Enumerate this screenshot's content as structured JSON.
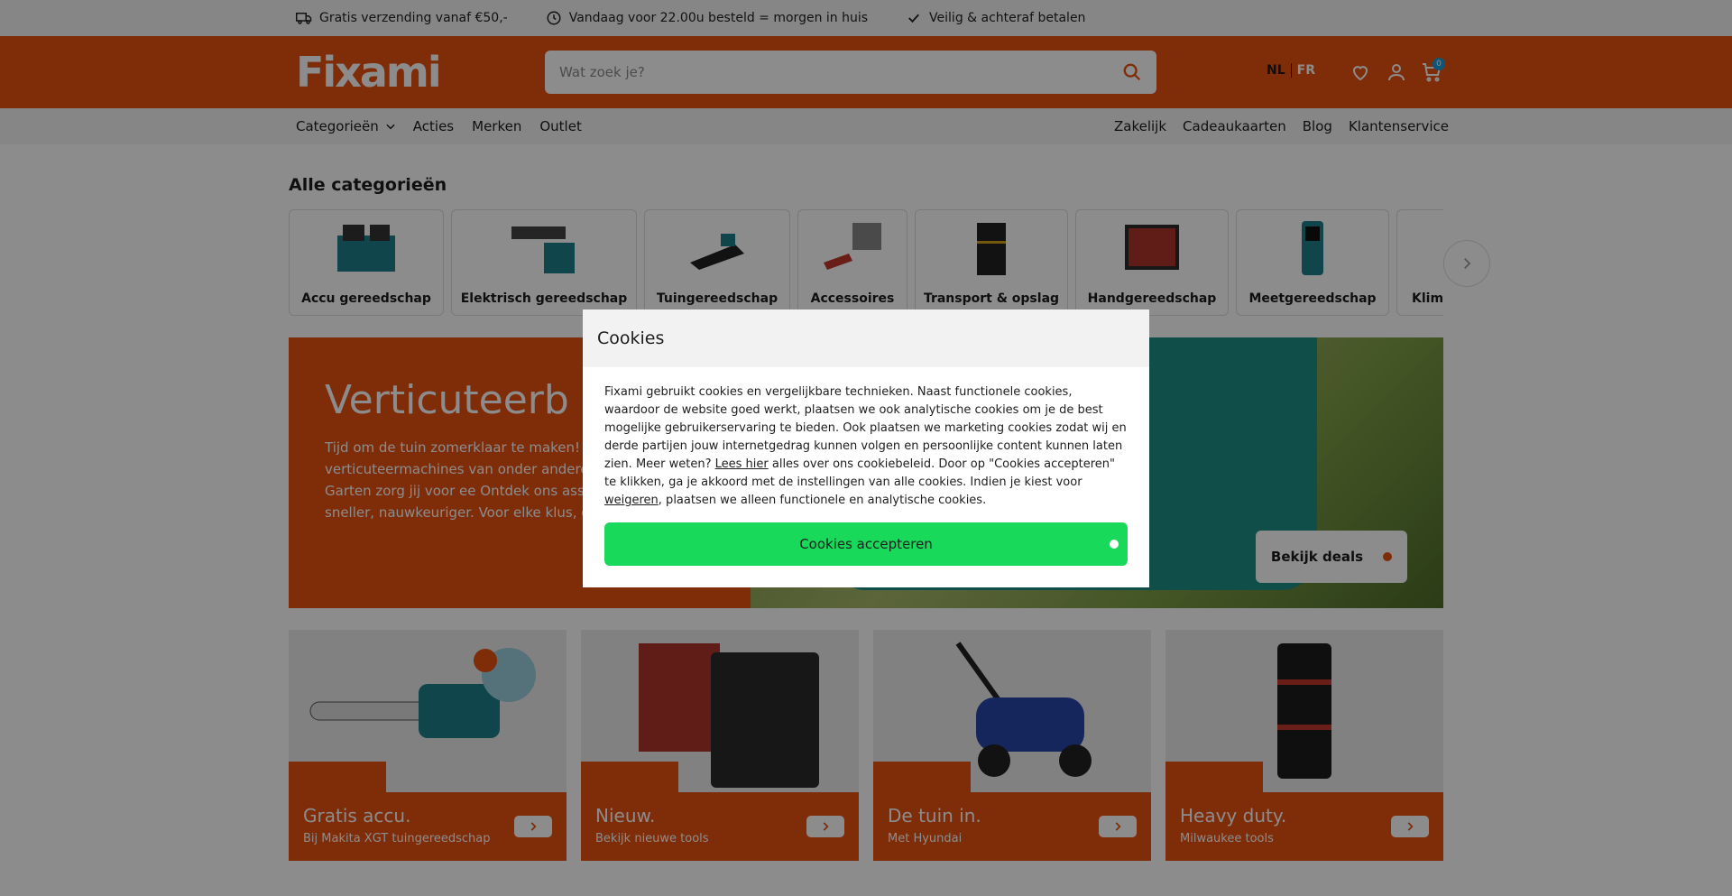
{
  "usp": [
    {
      "icon": "truck-icon",
      "text": "Gratis verzending vanaf €50,-"
    },
    {
      "icon": "clock-icon",
      "text": "Vandaag voor 22.00u besteld = morgen in huis"
    },
    {
      "icon": "check-icon",
      "text": "Veilig & achteraf betalen"
    }
  ],
  "header": {
    "logo": "Fixami",
    "search_placeholder": "Wat zoek je?",
    "lang_nl": "NL",
    "lang_fr": "FR",
    "cart_count": "0"
  },
  "nav": {
    "left": [
      "Categorieën",
      "Acties",
      "Merken",
      "Outlet"
    ],
    "right": [
      "Zakelijk",
      "Cadeaukaarten",
      "Blog",
      "Klantenservice"
    ]
  },
  "categories": {
    "title": "Alle categorieën",
    "items": [
      "Accu gereedschap",
      "Elektrisch gereedschap",
      "Tuingereedschap",
      "Accessoires",
      "Transport & opslag",
      "Handgereedschap",
      "Meetgereedschap",
      "Klima"
    ]
  },
  "hero": {
    "title": "Verticuteerb",
    "text": "Tijd om de tuin zomerklaar te maken! Me verticuteermachines van onder andere M Hyundai en WOLF-Garten zorg jij voor ee Ontdek ons assortiment en werk sneller, nauwkeuriger. Voor elke klus, groot of kle",
    "button": "Bekijk deals"
  },
  "promos": [
    {
      "title": "Gratis accu.",
      "sub": "Bij Makita XGT tuingereedschap"
    },
    {
      "title": "Nieuw.",
      "sub": "Bekijk nieuwe tools"
    },
    {
      "title": "De tuin in.",
      "sub": "Met Hyundai"
    },
    {
      "title": "Heavy duty.",
      "sub": "Milwaukee tools"
    }
  ],
  "cookie": {
    "title": "Cookies",
    "text_1": "Fixami gebruikt cookies en vergelijkbare technieken. Naast functionele cookies, waardoor de website goed werkt, plaatsen we ook analytische cookies om je de best mogelijke gebruikerservaring te bieden. Ook plaatsen we marketing cookies zodat wij en derde partijen jouw internetgedrag kunnen volgen en persoonlijke content kunnen laten zien. Meer weten? ",
    "link_lees": "Lees hier",
    "text_2": " alles over ons cookiebeleid. Door op \"Cookies accepteren\" te klikken, ga je akkoord met de instellingen van alle cookies. Indien je kiest voor ",
    "link_weigeren": "weigeren",
    "text_3": ", plaatsen we alleen functionele en analytische cookies.",
    "accept": "Cookies accepteren"
  },
  "colors": {
    "brand": "#e8500f",
    "accept": "#19d95a",
    "badge": "#1a9cd8"
  }
}
